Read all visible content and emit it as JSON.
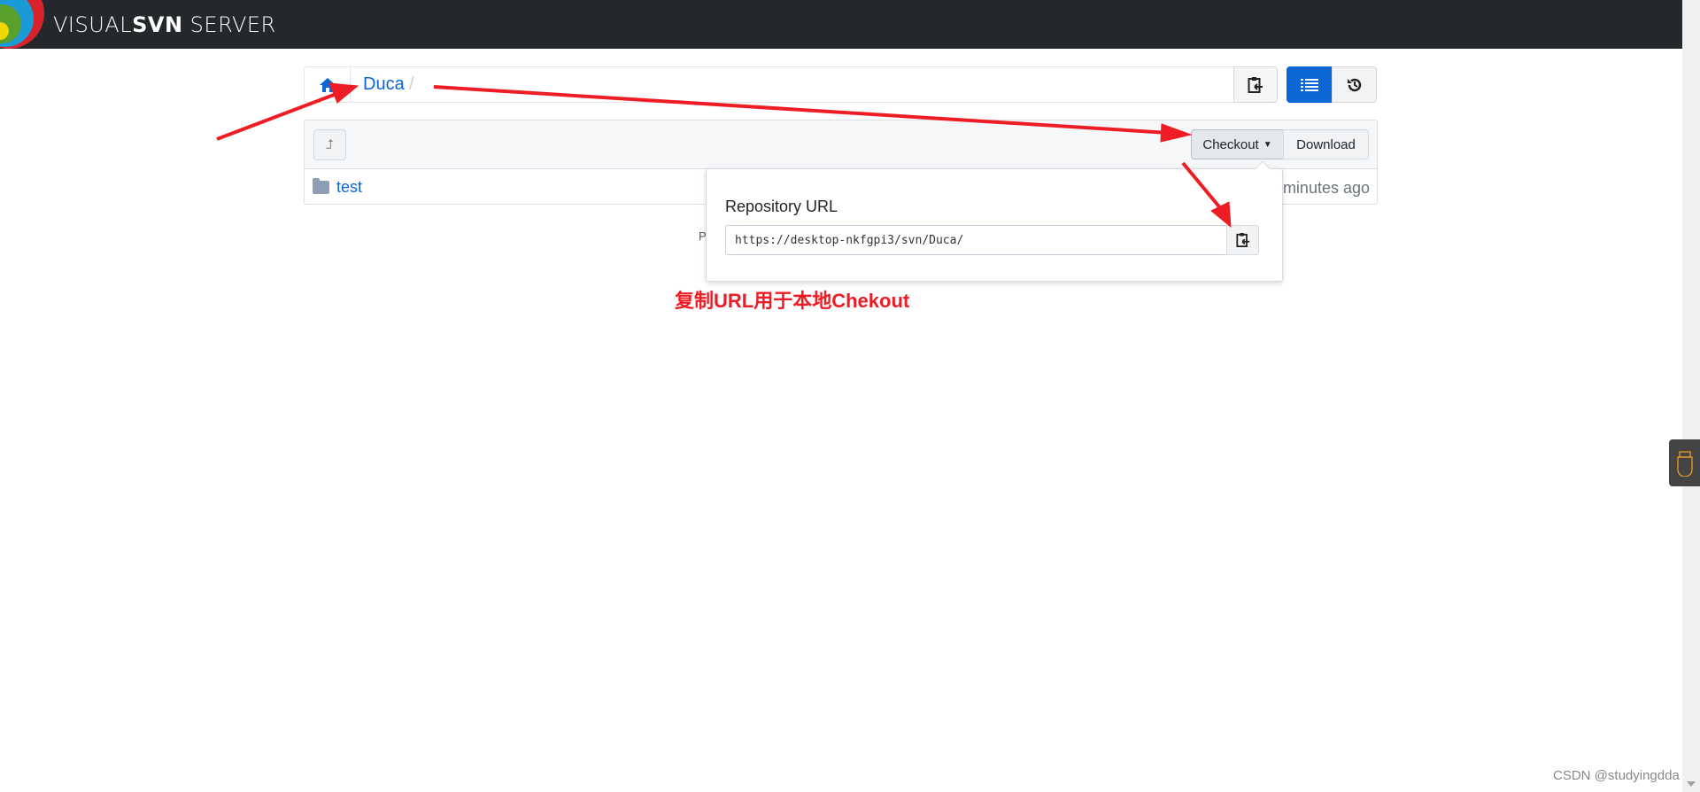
{
  "header": {
    "brand_light": "VISUAL",
    "brand_bold": "SVN",
    "brand_tail": " SERVER"
  },
  "breadcrumb": {
    "items": [
      {
        "label": "Duca"
      }
    ],
    "separator": "/"
  },
  "toolbar": {
    "checkout_label": "Checkout",
    "download_label": "Download"
  },
  "files": [
    {
      "name": "test",
      "modified": "minutes ago",
      "icon": "folder-icon"
    }
  ],
  "footer": {
    "text": "P"
  },
  "popover": {
    "title": "Repository URL",
    "url": "https://desktop-nkfgpi3/svn/Duca/"
  },
  "annotation": {
    "text": "复制URL用于本地Chekout",
    "color": "#ee1c25"
  },
  "watermark": "CSDN @studyingdda",
  "colors": {
    "accent": "#0b66d6",
    "header_bg": "#24282d"
  }
}
